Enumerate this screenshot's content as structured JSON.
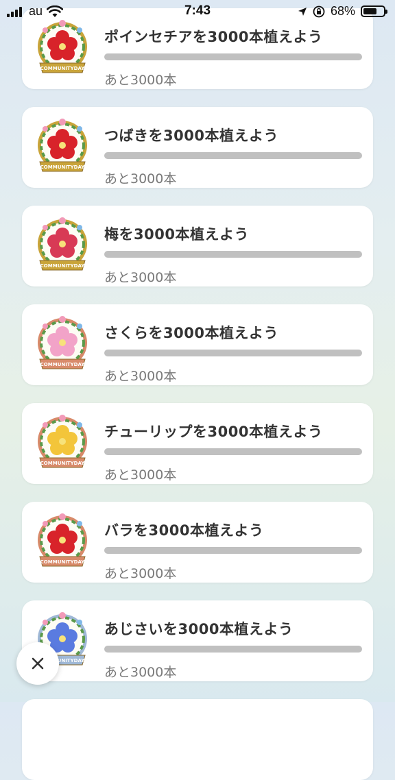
{
  "status_bar": {
    "carrier": "au",
    "time": "7:43",
    "battery_text": "68%",
    "battery_level": 0.68,
    "icons": [
      "signal-icon",
      "wifi-icon",
      "location-icon",
      "orientation-lock-icon",
      "battery-icon"
    ]
  },
  "missions": [
    {
      "title": "ポインセチアを3000本植えよう",
      "remaining": "あと3000本",
      "progress": 0,
      "flower_color": "#d8232a",
      "frame": "#c9a43a"
    },
    {
      "title": "つばきを3000本植えよう",
      "remaining": "あと3000本",
      "progress": 0,
      "flower_color": "#d8232a",
      "frame": "#c9a43a"
    },
    {
      "title": "梅を3000本植えよう",
      "remaining": "あと3000本",
      "progress": 0,
      "flower_color": "#d83a55",
      "frame": "#c9a43a"
    },
    {
      "title": "さくらを3000本植えよう",
      "remaining": "あと3000本",
      "progress": 0,
      "flower_color": "#f2a3c8",
      "frame": "#d88a6a"
    },
    {
      "title": "チューリップを3000本植えよう",
      "remaining": "あと3000本",
      "progress": 0,
      "flower_color": "#f3c53a",
      "frame": "#d88a6a"
    },
    {
      "title": "バラを3000本植えよう",
      "remaining": "あと3000本",
      "progress": 0,
      "flower_color": "#d8232a",
      "frame": "#d88a6a"
    },
    {
      "title": "あじさいを3000本植えよう",
      "remaining": "あと3000本",
      "progress": 0,
      "flower_color": "#5a7be0",
      "frame": "#9fb8d6"
    }
  ],
  "badge_banner_text": "COMMUNITYDAY",
  "close_button": {
    "icon": "close-icon"
  }
}
